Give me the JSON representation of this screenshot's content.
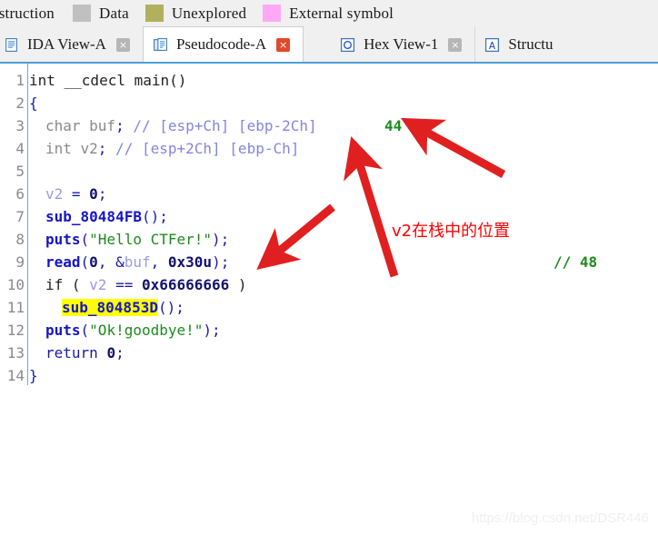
{
  "legend": {
    "first_label": "nstruction",
    "items": [
      {
        "label": "Data",
        "color": "#c0c0c0"
      },
      {
        "label": "Unexplored",
        "color": "#b0b05f"
      },
      {
        "label": "External symbol",
        "color": "#ffa8f5"
      }
    ]
  },
  "tabs": [
    {
      "label": "IDA View-A",
      "icon": "document-icon",
      "active": false,
      "close": "×"
    },
    {
      "label": "Pseudocode-A",
      "icon": "pseudocode-icon",
      "active": true,
      "close": "×"
    },
    {
      "label": "Hex View-1",
      "icon": "hex-view-icon",
      "active": false,
      "close": "×"
    },
    {
      "label": "Structu",
      "icon": "structures-icon",
      "active": false,
      "close": ""
    }
  ],
  "code": {
    "line_numbers": [
      "1",
      "2",
      "3",
      "4",
      "5",
      "6",
      "7",
      "8",
      "9",
      "10",
      "11",
      "12",
      "13",
      "14"
    ],
    "lines": [
      {
        "n": "1",
        "text": "int __cdecl main()"
      },
      {
        "n": "2",
        "text": "{"
      },
      {
        "n": "3",
        "text": "  char buf; // [esp+Ch] [ebp-2Ch]"
      },
      {
        "n": "4",
        "text": "  int v2; // [esp+2Ch] [ebp-Ch]"
      },
      {
        "n": "5",
        "text": ""
      },
      {
        "n": "6",
        "text": "  v2 = 0;"
      },
      {
        "n": "7",
        "text": "  sub_80484FB();"
      },
      {
        "n": "8",
        "text": "  puts(\"Hello CTFer!\");"
      },
      {
        "n": "9",
        "text": "  read(0, &buf, 0x30u);"
      },
      {
        "n": "10",
        "text": "  if ( v2 == 0x66666666 )"
      },
      {
        "n": "11",
        "text": "    sub_804853D();"
      },
      {
        "n": "12",
        "text": "  puts(\"Ok!goodbye!\");"
      },
      {
        "n": "13",
        "text": "  return 0;"
      },
      {
        "n": "14",
        "text": "}"
      }
    ],
    "tokens": {
      "l1_type": "int ",
      "l1_conv": "__cdecl ",
      "l1_name": "main",
      "l1_paren": "()",
      "l2_brace": "{",
      "l3_decl": "char buf",
      "l3_semi": ";",
      "l3_comment": " // [esp+Ch] [ebp-2Ch]",
      "l4_decl": "int v2",
      "l4_semi": ";",
      "l4_comment": " // [esp+2Ch] [ebp-Ch]",
      "l6_var": "v2",
      "l6_op": " = ",
      "l6_num": "0",
      "l6_semi": ";",
      "l7_func": "sub_80484FB",
      "l7_tail": "();",
      "l8_func": "puts",
      "l8_open": "(",
      "l8_str": "\"Hello CTFer!\"",
      "l8_close": ");",
      "l9_func": "read",
      "l9_open": "(",
      "l9_arg0": "0",
      "l9_comma1": ", &",
      "l9_buf": "buf",
      "l9_comma2": ", ",
      "l9_size": "0x30u",
      "l9_close": ");",
      "l10_if": "if ( ",
      "l10_var": "v2",
      "l10_op": " == ",
      "l10_num": "0x66666666",
      "l10_close": " )",
      "l11_hl": "sub_804853D",
      "l11_tail": "();",
      "l12_func": "puts",
      "l12_open": "(",
      "l12_str": "\"Ok!goodbye!\"",
      "l12_close": ");",
      "l13_ret": "return ",
      "l13_num": "0",
      "l13_semi": ";",
      "l14_brace": "}"
    }
  },
  "annotations": {
    "offset_44": "44",
    "offset_48": "// 48",
    "chinese_note": "v2在栈中的位置",
    "arrow_color": "#e02020",
    "green_color": "#1c8a1c",
    "red_color": "#ff0000"
  },
  "watermark": {
    "text": "https://blog.csdn.net/DSR446"
  }
}
